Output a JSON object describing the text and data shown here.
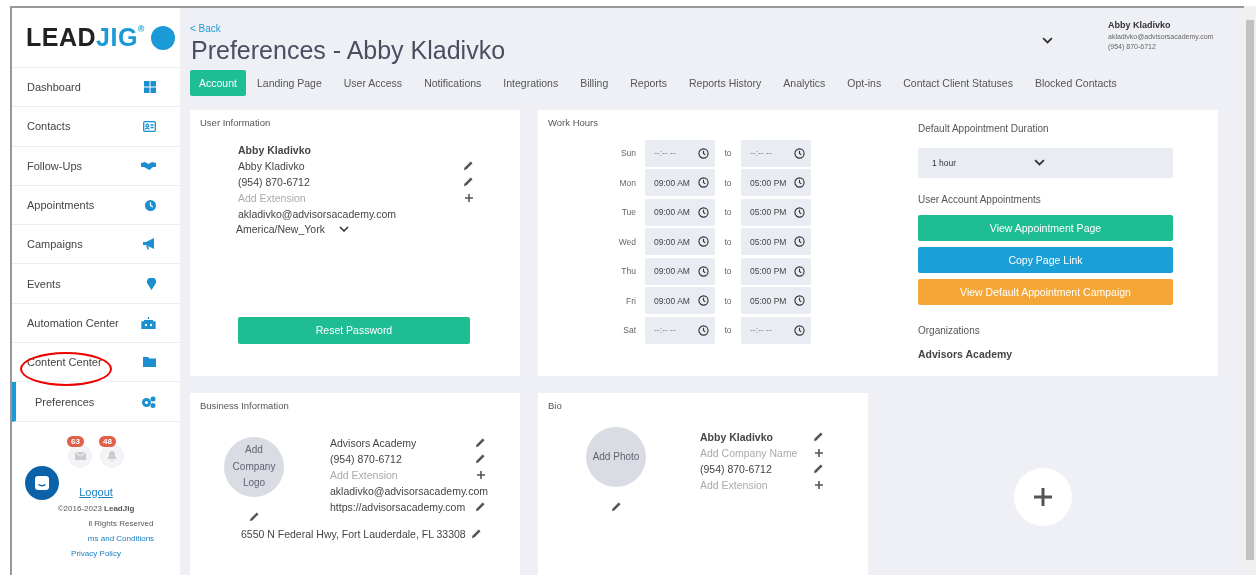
{
  "logo": {
    "word": "LEAD",
    "accent": "JIG",
    "mark": "®"
  },
  "sidebar": {
    "items": [
      {
        "label": "Dashboard",
        "selected": false
      },
      {
        "label": "Contacts",
        "selected": false
      },
      {
        "label": "Follow-Ups",
        "selected": false
      },
      {
        "label": "Appointments",
        "selected": false
      },
      {
        "label": "Campaigns",
        "selected": false
      },
      {
        "label": "Events",
        "selected": false
      },
      {
        "label": "Automation Center",
        "selected": false
      },
      {
        "label": "Content Center",
        "selected": false
      },
      {
        "label": "Preferences",
        "selected": true
      }
    ],
    "badges": {
      "messages": "63",
      "alerts": "48"
    },
    "logout": "Logout",
    "footer": {
      "copyright": "©2016-2023 **LeadJig**",
      "rights": "ll Rights Reserved",
      "terms": "ms and Conditions",
      "privacy": "Privacy Policy"
    }
  },
  "header": {
    "back": "< Back",
    "title": "Preferences - Abby Kladivko",
    "user": {
      "name": "Abby Kladivko",
      "email": "akladivko@advisorsacademy.com",
      "phone": "(954) 870-6712"
    }
  },
  "tabs": [
    {
      "label": "Account",
      "selected": true
    },
    {
      "label": "Landing Page",
      "selected": false
    },
    {
      "label": "User Access",
      "selected": false
    },
    {
      "label": "Notifications",
      "selected": false
    },
    {
      "label": "Integrations",
      "selected": false
    },
    {
      "label": "Billing",
      "selected": false
    },
    {
      "label": "Reports",
      "selected": false
    },
    {
      "label": "Reports History",
      "selected": false
    },
    {
      "label": "Analytics",
      "selected": false
    },
    {
      "label": "Opt-ins",
      "selected": false
    },
    {
      "label": "Contact Client Statuses",
      "selected": false
    },
    {
      "label": "Blocked Contacts",
      "selected": false
    }
  ],
  "user_information": {
    "title": "User Information",
    "name": "Abby Kladivko",
    "rows": [
      {
        "kind": "edit",
        "text": "Abby Kladivko"
      },
      {
        "kind": "edit",
        "text": "(954) 870-6712"
      },
      {
        "kind": "add",
        "text": "Add Extension"
      },
      {
        "kind": "plain",
        "text": "akladivko@advisorsacademy.com"
      }
    ],
    "timezone": "America/New_York",
    "reset_button": "Reset Password"
  },
  "work_hours": {
    "title": "Work Hours",
    "days": [
      {
        "day": "Sun",
        "from": {
          "placeholder": "--:-- --"
        },
        "separator": "to",
        "to": {
          "placeholder": "--:-- --"
        }
      },
      {
        "day": "Mon",
        "from": {
          "value": "09:00 AM"
        },
        "separator": "to",
        "to": {
          "value": "05:00 PM"
        }
      },
      {
        "day": "Tue",
        "from": {
          "value": "09:00 AM"
        },
        "separator": "to",
        "to": {
          "value": "05:00 PM"
        }
      },
      {
        "day": "Wed",
        "from": {
          "value": "09:00 AM"
        },
        "separator": "to",
        "to": {
          "value": "05:00 PM"
        }
      },
      {
        "day": "Thu",
        "from": {
          "value": "09:00 AM"
        },
        "separator": "to",
        "to": {
          "value": "05:00 PM"
        }
      },
      {
        "day": "Fri",
        "from": {
          "value": "09:00 AM"
        },
        "separator": "to",
        "to": {
          "value": "05:00 PM"
        }
      },
      {
        "day": "Sat",
        "from": {
          "placeholder": "--:-- --"
        },
        "separator": "to",
        "to": {
          "placeholder": "--:-- --"
        }
      }
    ]
  },
  "appointments": {
    "duration_label": "Default Appointment Duration",
    "duration": "1 hour",
    "section_label": "User Account Appointments",
    "buttons": [
      {
        "label": "View Appointment Page",
        "color": "#1fbd94"
      },
      {
        "label": "Copy Page Link",
        "color": "#1b9fd7"
      },
      {
        "label": "View Default Appointment Campaign",
        "color": "#f4a736"
      }
    ],
    "organizations_label": "Organizations",
    "organization": "Advisors Academy"
  },
  "business_information": {
    "title": "Business Information",
    "logo_placeholder": "Add Company Logo",
    "rows": [
      {
        "kind": "edit",
        "text": "Advisors Academy"
      },
      {
        "kind": "edit",
        "text": "(954) 870-6712"
      },
      {
        "kind": "add",
        "text": "Add Extension"
      },
      {
        "kind": "plain",
        "text": "akladivko@advisorsacademy.com"
      },
      {
        "kind": "edit",
        "text": "https://advisorsacademy.com"
      }
    ],
    "address": "6550 N Federal Hwy, Fort Lauderdale, FL 33308"
  },
  "bio": {
    "title": "Bio",
    "photo_placeholder": "Add Photo",
    "name": "Abby Kladivko",
    "rows": [
      {
        "kind": "add",
        "text": "Add Company Name"
      },
      {
        "kind": "edit",
        "text": "(954) 870-6712"
      },
      {
        "kind": "add",
        "text": "Add Extension"
      }
    ]
  }
}
